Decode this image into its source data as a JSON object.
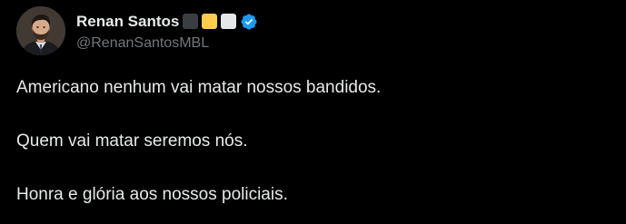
{
  "author": {
    "display_name": "Renan Santos",
    "handle": "@RenanSantosMBL",
    "avatar_icon": "profile-photo",
    "verified_icon": "verified-badge-icon",
    "verified_color": "#1d9bf0",
    "name_emoji_colors": [
      "#3a3d41",
      "#ffcc4d",
      "#e6e7e8"
    ]
  },
  "tweet": {
    "lines": [
      "Americano nenhum vai matar nossos bandidos.",
      "Quem vai matar seremos nós.",
      "Honra e glória aos nossos policiais."
    ]
  },
  "theme": {
    "background": "#000000",
    "text": "#e7e9ea",
    "secondary_text": "#71767b"
  }
}
